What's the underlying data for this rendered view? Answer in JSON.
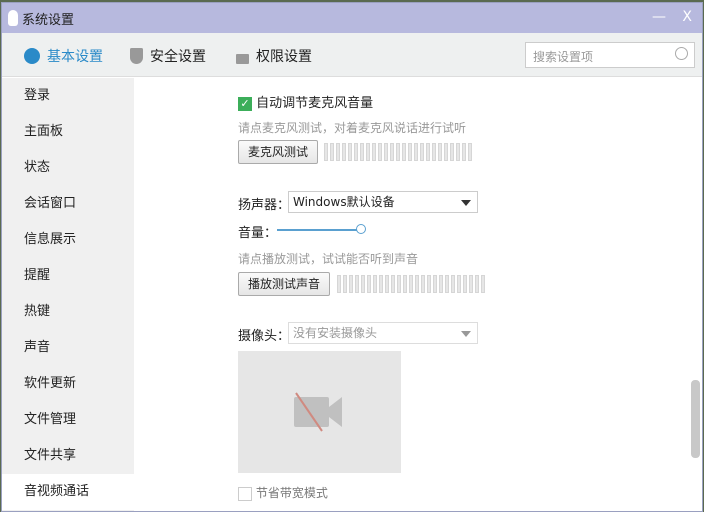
{
  "window": {
    "title": "系统设置",
    "minimize": "—",
    "close": "X"
  },
  "tabs": [
    {
      "label": "基本设置",
      "active": true
    },
    {
      "label": "安全设置"
    },
    {
      "label": "权限设置"
    }
  ],
  "search": {
    "placeholder": "搜索设置项"
  },
  "sidebar": {
    "items": [
      "登录",
      "主面板",
      "状态",
      "会话窗口",
      "信息展示",
      "提醒",
      "热键",
      "声音",
      "软件更新",
      "文件管理",
      "文件共享",
      "音视频通话"
    ],
    "selected": 11
  },
  "mic": {
    "auto_adjust_label": "自动调节麦克风音量",
    "auto_adjust_checked": true,
    "hint": "请点麦克风测试，对着麦克风说话进行试听",
    "test_button": "麦克风测试"
  },
  "speaker": {
    "label": "扬声器：",
    "value": "Windows默认设备",
    "volume_label": "音量：",
    "volume_percent": 100,
    "hint": "请点播放测试，试试能否听到声音",
    "test_button": "播放测试声音"
  },
  "camera": {
    "label": "摄像头：",
    "value": "没有安装摄像头",
    "bandwidth_label": "节省带宽模式",
    "bandwidth_checked": false
  },
  "colors": {
    "accent": "#2a8ac8",
    "titlebar": "#b7b9de",
    "check": "#3cae5a"
  }
}
